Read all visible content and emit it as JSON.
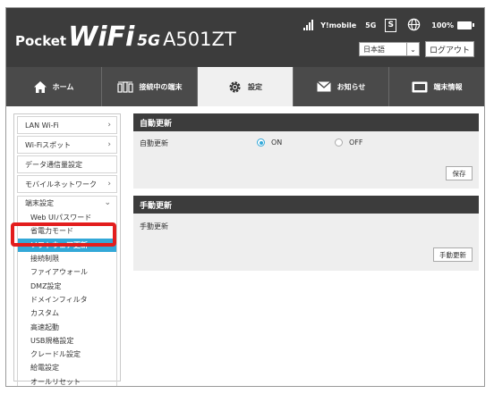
{
  "header": {
    "logo_pocket": "Pocket",
    "logo_wifi": "WiFi",
    "logo_5g": "5G",
    "logo_model": "A501ZT",
    "carrier": "Y!mobile",
    "network": "5G",
    "sim_label": "S",
    "battery": "100%",
    "language": "日本語",
    "logout_label": "ログアウト"
  },
  "nav": {
    "tabs": [
      {
        "label": "ホーム",
        "icon": "home-icon"
      },
      {
        "label": "接続中の端末",
        "icon": "devices-icon"
      },
      {
        "label": "設定",
        "icon": "gear-icon",
        "active": true
      },
      {
        "label": "お知らせ",
        "icon": "mail-icon"
      },
      {
        "label": "端末情報",
        "icon": "device-info-icon"
      }
    ]
  },
  "sidebar": {
    "top_items": [
      "LAN Wi-Fi",
      "Wi-Fiスポット",
      "データ通信量設定",
      "モバイルネットワーク"
    ],
    "group_label": "端末設定",
    "sub_items": [
      "Web UIパスワード",
      "省電力モード",
      "ソフトウェア更新",
      "接続制限",
      "ファイアウォール",
      "DMZ設定",
      "ドメインフィルタ",
      "カスタム",
      "高速起動",
      "USB規格設定",
      "クレードル設定",
      "給電設定",
      "オールリセット"
    ],
    "active_sub_item": "ソフトウェア更新"
  },
  "main": {
    "auto_update": {
      "title": "自動更新",
      "row_label": "自動更新",
      "option_on": "ON",
      "option_off": "OFF",
      "selected": "ON",
      "save_label": "保存"
    },
    "manual_update": {
      "title": "手動更新",
      "row_label": "手動更新",
      "button_label": "手動更新"
    }
  },
  "colors": {
    "header_bg": "#3c3c3c",
    "accent": "#33a8d8",
    "highlight": "#e31d1d"
  }
}
